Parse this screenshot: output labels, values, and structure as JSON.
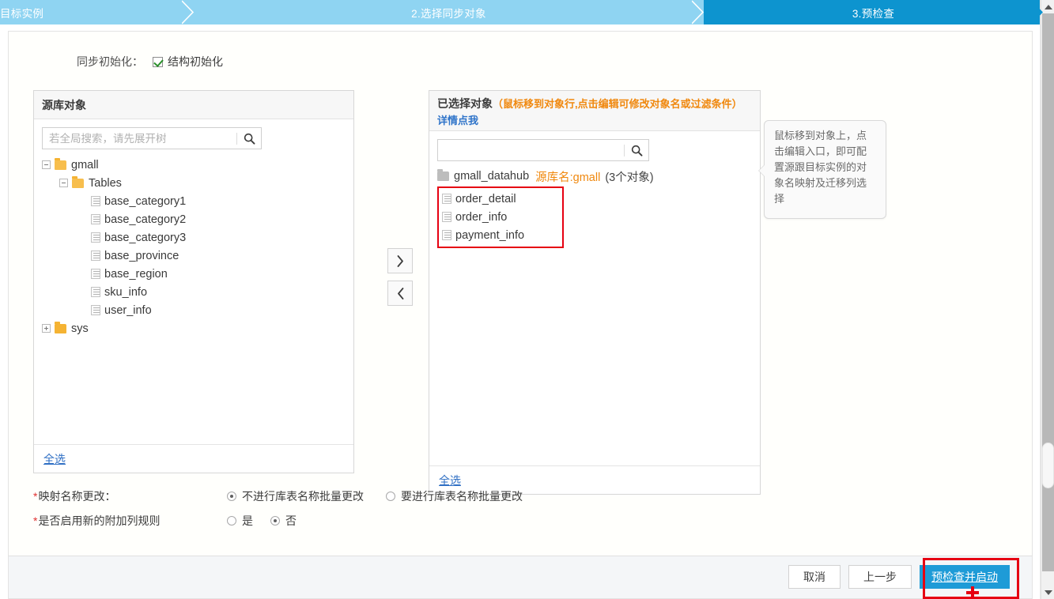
{
  "steps": [
    {
      "label": "目标实例",
      "state": "done"
    },
    {
      "label": "2.选择同步对象",
      "state": "done"
    },
    {
      "label": "3.预检查",
      "state": "active"
    }
  ],
  "sync_init": {
    "label": "同步初始化：",
    "checkbox_label": "结构初始化",
    "checked": true
  },
  "source_panel": {
    "title": "源库对象",
    "search_placeholder": "若全局搜索，请先展开树",
    "search_value": "",
    "select_all": "全选",
    "tree": [
      {
        "label": "gmall",
        "level": 1,
        "type": "folder",
        "expanded": true
      },
      {
        "label": "Tables",
        "level": 2,
        "type": "folder",
        "expanded": true
      },
      {
        "label": "base_category1",
        "level": 3,
        "type": "table"
      },
      {
        "label": "base_category2",
        "level": 3,
        "type": "table"
      },
      {
        "label": "base_category3",
        "level": 3,
        "type": "table"
      },
      {
        "label": "base_province",
        "level": 3,
        "type": "table"
      },
      {
        "label": "base_region",
        "level": 3,
        "type": "table"
      },
      {
        "label": "sku_info",
        "level": 3,
        "type": "table"
      },
      {
        "label": "user_info",
        "level": 3,
        "type": "table"
      },
      {
        "label": "sys",
        "level": 1,
        "type": "folder",
        "expanded": false
      }
    ]
  },
  "transfer": {
    "to_right": "›",
    "to_left": "‹"
  },
  "selected_panel": {
    "title": "已选择对象",
    "hint": "（鼠标移到对象行,点击编辑可修改对象名或过滤条件）",
    "hint_link": "详情点我",
    "search_placeholder": "",
    "search_value": "",
    "select_all": "全选",
    "root": {
      "name": "gmall_datahub",
      "source_label": "源库名:gmall",
      "count_label": "(3个对象)"
    },
    "items": [
      {
        "label": "order_detail"
      },
      {
        "label": "order_info"
      },
      {
        "label": "payment_info"
      }
    ]
  },
  "tooltip": {
    "text": "鼠标移到对象上，点击编辑入口，即可配置源跟目标实例的对象名映射及迁移列选择"
  },
  "form": {
    "mapping": {
      "label": "映射名称更改：",
      "required": true,
      "options": [
        {
          "label": "不进行库表名称批量更改",
          "selected": true
        },
        {
          "label": "要进行库表名称批量更改",
          "selected": false
        }
      ]
    },
    "extra_column_rule": {
      "label": "是否启用新的附加列规则",
      "required": true,
      "options": [
        {
          "label": "是",
          "selected": false
        },
        {
          "label": "否",
          "selected": true
        }
      ]
    }
  },
  "footer": {
    "cancel": "取消",
    "previous": "上一步",
    "submit": "预检查并启动"
  },
  "colors": {
    "step_done": "#8fd4f2",
    "step_active": "#0d94cf",
    "accent_orange": "#f0880e",
    "link_blue": "#2f6fc4",
    "highlight_red": "#e60012",
    "primary_button": "#1e9bd7"
  }
}
